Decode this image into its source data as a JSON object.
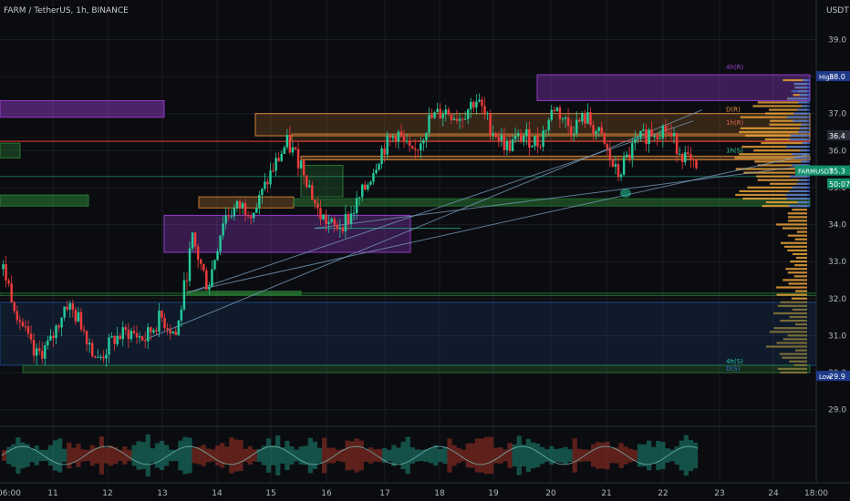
{
  "header": {
    "title": "FARM / TetherUS, 1h, BINANCE",
    "currency": "USDT"
  },
  "colors": {
    "background": "#0b0c10",
    "up": "#26c99a",
    "down": "#ef3b3b",
    "grid": "#1b1d24",
    "axis_text": "#b2b5be",
    "purple_zone": "#9c3fd6",
    "orange_zone": "#e8913a",
    "green_zone": "#2e8b3a",
    "blue_zone": "#1e4d8c",
    "volume_profile": "#e8a23a",
    "volume_profile_blue": "#3a6fd8"
  },
  "chart_data": {
    "type": "candlestick",
    "title": "FARM / TetherUS, 1h, BINANCE",
    "ylim": [
      28.5,
      39.7
    ],
    "y_ticks": [
      29.0,
      30.0,
      31.0,
      32.0,
      33.0,
      34.0,
      35.0,
      36.0,
      37.0,
      38.0,
      39.0
    ],
    "x_ticks": [
      "06:00",
      "11",
      "12",
      "13",
      "14",
      "15",
      "16",
      "17",
      "18",
      "19",
      "20",
      "21",
      "22",
      "23",
      "24",
      "18:00"
    ],
    "grid": true,
    "price_path": [
      32.8,
      31.5,
      30.4,
      30.8,
      31.9,
      31.3,
      30.3,
      30.9,
      31.1,
      30.9,
      31.5,
      31.0,
      33.6,
      32.3,
      34.2,
      34.5,
      34.4,
      35.4,
      36.2,
      35.6,
      34.3,
      33.9,
      34.2,
      35.0,
      36.0,
      36.5,
      35.8,
      36.8,
      37.1,
      36.9,
      37.4,
      36.6,
      36.1,
      36.4,
      36.2,
      37.2,
      36.6,
      36.9,
      36.3,
      35.3,
      36.1,
      36.5,
      36.6,
      36.0,
      35.4
    ],
    "price_labels": [
      {
        "label": "High",
        "value": "38.0"
      },
      {
        "label": "Low",
        "value": "29.9"
      },
      {
        "label": "",
        "value": "36.4"
      },
      {
        "label": "FARMUSDT",
        "value": "35.3"
      },
      {
        "label": "",
        "value": "50:07"
      }
    ],
    "level_labels": [
      "4h(R)",
      "D(R)",
      "1h(R)",
      "1h(S)",
      "4h(S)",
      "D(S)"
    ],
    "oscillator_ticks": [
      "1.0",
      "0.0"
    ]
  }
}
